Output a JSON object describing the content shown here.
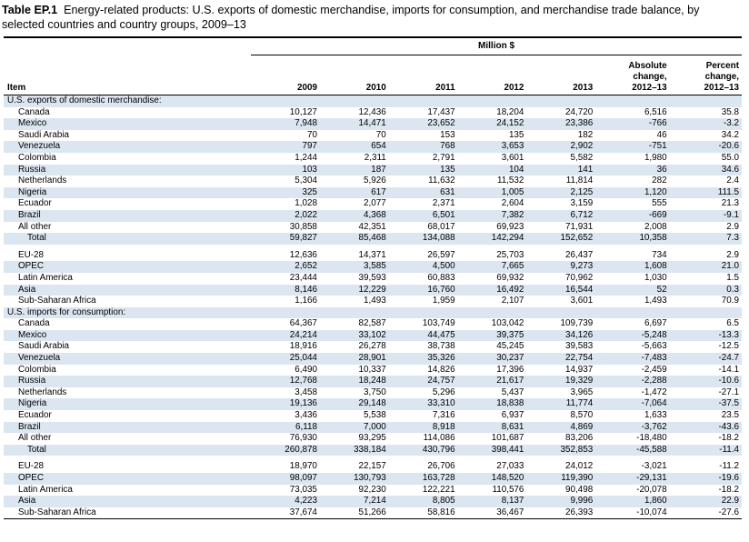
{
  "title": {
    "label": "Table EP.1",
    "text": "Energy-related products: U.S. exports of domestic merchandise, imports for consumption, and merchandise trade balance, by selected countries and country groups, 2009–13"
  },
  "units": "Million $",
  "columns": {
    "item": "Item",
    "years": [
      "2009",
      "2010",
      "2011",
      "2012",
      "2013"
    ],
    "abs_change": [
      "Absolute",
      "change,",
      "2012–13"
    ],
    "pct_change": [
      "Percent",
      "change,",
      "2012–13"
    ]
  },
  "colors": {
    "row_shade": "#dce6f1",
    "rule": "#000000"
  },
  "exports": {
    "heading": "U.S. exports of domestic merchandise:",
    "rows": [
      {
        "name": "Canada",
        "v": [
          "10,127",
          "12,436",
          "17,437",
          "18,204",
          "24,720",
          "6,516",
          "35.8"
        ]
      },
      {
        "name": "Mexico",
        "v": [
          "7,948",
          "14,471",
          "23,652",
          "24,152",
          "23,386",
          "-766",
          "-3.2"
        ]
      },
      {
        "name": "Saudi Arabia",
        "v": [
          "70",
          "70",
          "153",
          "135",
          "182",
          "46",
          "34.2"
        ]
      },
      {
        "name": "Venezuela",
        "v": [
          "797",
          "654",
          "768",
          "3,653",
          "2,902",
          "-751",
          "-20.6"
        ]
      },
      {
        "name": "Colombia",
        "v": [
          "1,244",
          "2,311",
          "2,791",
          "3,601",
          "5,582",
          "1,980",
          "55.0"
        ]
      },
      {
        "name": "Russia",
        "v": [
          "103",
          "187",
          "135",
          "104",
          "141",
          "36",
          "34.6"
        ]
      },
      {
        "name": "Netherlands",
        "v": [
          "5,304",
          "5,926",
          "11,632",
          "11,532",
          "11,814",
          "282",
          "2.4"
        ]
      },
      {
        "name": "Nigeria",
        "v": [
          "325",
          "617",
          "631",
          "1,005",
          "2,125",
          "1,120",
          "111.5"
        ]
      },
      {
        "name": "Ecuador",
        "v": [
          "1,028",
          "2,077",
          "2,371",
          "2,604",
          "3,159",
          "555",
          "21.3"
        ]
      },
      {
        "name": "Brazil",
        "v": [
          "2,022",
          "4,368",
          "6,501",
          "7,382",
          "6,712",
          "-669",
          "-9.1"
        ]
      },
      {
        "name": "All other",
        "v": [
          "30,858",
          "42,351",
          "68,017",
          "69,923",
          "71,931",
          "2,008",
          "2.9"
        ]
      },
      {
        "name": "Total",
        "v": [
          "59,827",
          "85,468",
          "134,088",
          "142,294",
          "152,652",
          "10,358",
          "7.3"
        ]
      }
    ],
    "groups": [
      {
        "name": "EU-28",
        "v": [
          "12,636",
          "14,371",
          "26,597",
          "25,703",
          "26,437",
          "734",
          "2.9"
        ]
      },
      {
        "name": "OPEC",
        "v": [
          "2,652",
          "3,585",
          "4,500",
          "7,665",
          "9,273",
          "1,608",
          "21.0"
        ]
      },
      {
        "name": "Latin America",
        "v": [
          "23,444",
          "39,593",
          "60,883",
          "69,932",
          "70,962",
          "1,030",
          "1.5"
        ]
      },
      {
        "name": "Asia",
        "v": [
          "8,146",
          "12,229",
          "16,760",
          "16,492",
          "16,544",
          "52",
          "0.3"
        ]
      },
      {
        "name": "Sub-Saharan Africa",
        "v": [
          "1,166",
          "1,493",
          "1,959",
          "2,107",
          "3,601",
          "1,493",
          "70.9"
        ]
      }
    ]
  },
  "imports": {
    "heading": "U.S. imports for consumption:",
    "rows": [
      {
        "name": "Canada",
        "v": [
          "64,367",
          "82,587",
          "103,749",
          "103,042",
          "109,739",
          "6,697",
          "6.5"
        ]
      },
      {
        "name": "Mexico",
        "v": [
          "24,214",
          "33,102",
          "44,475",
          "39,375",
          "34,126",
          "-5,248",
          "-13.3"
        ]
      },
      {
        "name": "Saudi Arabia",
        "v": [
          "18,916",
          "26,278",
          "38,738",
          "45,245",
          "39,583",
          "-5,663",
          "-12.5"
        ]
      },
      {
        "name": "Venezuela",
        "v": [
          "25,044",
          "28,901",
          "35,326",
          "30,237",
          "22,754",
          "-7,483",
          "-24.7"
        ]
      },
      {
        "name": "Colombia",
        "v": [
          "6,490",
          "10,337",
          "14,826",
          "17,396",
          "14,937",
          "-2,459",
          "-14.1"
        ]
      },
      {
        "name": "Russia",
        "v": [
          "12,768",
          "18,248",
          "24,757",
          "21,617",
          "19,329",
          "-2,288",
          "-10.6"
        ]
      },
      {
        "name": "Netherlands",
        "v": [
          "3,458",
          "3,750",
          "5,296",
          "5,437",
          "3,965",
          "-1,472",
          "-27.1"
        ]
      },
      {
        "name": "Nigeria",
        "v": [
          "19,136",
          "29,148",
          "33,310",
          "18,838",
          "11,774",
          "-7,064",
          "-37.5"
        ]
      },
      {
        "name": "Ecuador",
        "v": [
          "3,436",
          "5,538",
          "7,316",
          "6,937",
          "8,570",
          "1,633",
          "23.5"
        ]
      },
      {
        "name": "Brazil",
        "v": [
          "6,118",
          "7,000",
          "8,918",
          "8,631",
          "4,869",
          "-3,762",
          "-43.6"
        ]
      },
      {
        "name": "All other",
        "v": [
          "76,930",
          "93,295",
          "114,086",
          "101,687",
          "83,206",
          "-18,480",
          "-18.2"
        ]
      },
      {
        "name": "Total",
        "v": [
          "260,878",
          "338,184",
          "430,796",
          "398,441",
          "352,853",
          "-45,588",
          "-11.4"
        ]
      }
    ],
    "groups": [
      {
        "name": "EU-28",
        "v": [
          "18,970",
          "22,157",
          "26,706",
          "27,033",
          "24,012",
          "-3,021",
          "-11.2"
        ]
      },
      {
        "name": "OPEC",
        "v": [
          "98,097",
          "130,793",
          "163,728",
          "148,520",
          "119,390",
          "-29,131",
          "-19.6"
        ]
      },
      {
        "name": "Latin America",
        "v": [
          "73,035",
          "92,230",
          "122,221",
          "110,576",
          "90,498",
          "-20,078",
          "-18.2"
        ]
      },
      {
        "name": "Asia",
        "v": [
          "4,223",
          "7,214",
          "8,805",
          "8,137",
          "9,996",
          "1,860",
          "22.9"
        ]
      },
      {
        "name": "Sub-Saharan Africa",
        "v": [
          "37,674",
          "51,266",
          "58,816",
          "36,467",
          "26,393",
          "-10,074",
          "-27.6"
        ]
      }
    ]
  }
}
